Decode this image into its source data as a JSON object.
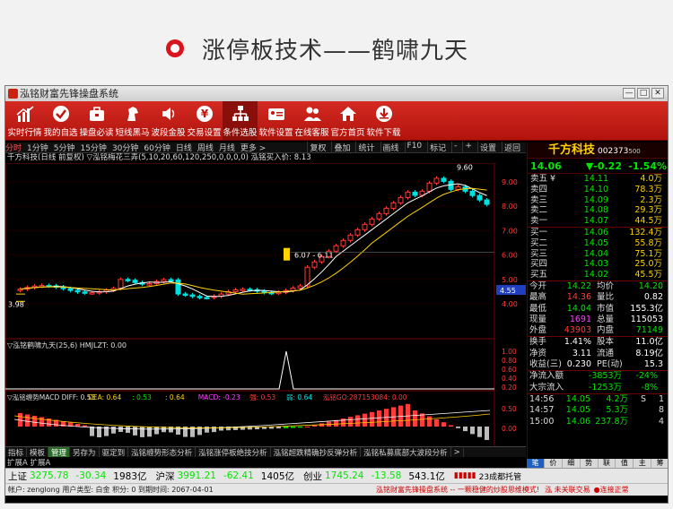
{
  "banner": {
    "title": "涨停板技术——鹤啸九天"
  },
  "window": {
    "title": "泓铭财富先锋操盘系统",
    "controls": [
      "—",
      "□",
      "✕"
    ]
  },
  "toolbar": [
    {
      "label": "实时行情",
      "icon": "bar-chart-icon"
    },
    {
      "label": "我的自选",
      "icon": "checkmark-circle-icon"
    },
    {
      "label": "操盘必读",
      "icon": "briefcase-icon"
    },
    {
      "label": "短线黑马",
      "icon": "horse-icon"
    },
    {
      "label": "波段金股",
      "icon": "speaker-icon"
    },
    {
      "label": "交易设置",
      "icon": "yen-coin-icon"
    },
    {
      "label": "条件选股",
      "icon": "hierarchy-icon"
    },
    {
      "label": "软件设置",
      "icon": "id-card-icon"
    },
    {
      "label": "在线客服",
      "icon": "users-icon"
    },
    {
      "label": "官方首页",
      "icon": "home-icon"
    },
    {
      "label": "软件下载",
      "icon": "download-icon"
    }
  ],
  "period_bar": {
    "items": [
      "分时",
      "1分钟",
      "5分钟",
      "15分钟",
      "30分钟",
      "60分钟",
      "日线",
      "周线",
      "月线",
      "更多 >"
    ],
    "selected": "日线",
    "right": [
      "复权",
      "叠加",
      "统计",
      "画线",
      "F10",
      "标记",
      "-",
      "+",
      "设置",
      "返回"
    ]
  },
  "main_chart": {
    "info_line": "千方科技(日线 前复权) ▽泓铭梅花三弄(5,10,20,60,120,250,0,0,0,0)  泓铭买入价: 8.13",
    "high_label": "9.60",
    "low_label": "3.98",
    "mid_label": "6.07 - 6.11",
    "y_ticks": [
      "9.00",
      "8.00",
      "7.00",
      "6.00",
      "5.00",
      "4.00"
    ],
    "current_price_tag": "4.55"
  },
  "sub_chart_1": {
    "info_line": "▽泓铭鹤啸九天(25,6)  HMJLZT: 0.00",
    "y_ticks": [
      "1.00",
      "0.80",
      "0.60",
      "0.40",
      "0.20"
    ]
  },
  "sub_chart_2": {
    "info_line_parts": [
      {
        "text": "▽泓铭缠势MACD  DIFF: 0.53",
        "color": "white"
      },
      {
        "text": "  DEA: 0.64",
        "color": "yellow"
      },
      {
        "text": "  : 0.53",
        "color": "green"
      },
      {
        "text": "  : 0.64",
        "color": "yellow"
      },
      {
        "text": "  MACD: -0.23",
        "color": "magenta"
      },
      {
        "text": "  强: 0.53",
        "color": "red"
      },
      {
        "text": "  弱: 0.64",
        "color": "cyan"
      },
      {
        "text": "  泓铭GO:287153084: 0.00",
        "color": "red"
      }
    ],
    "y_ticks": [
      "0.50",
      "0.00"
    ]
  },
  "x_axis": {
    "labels": [
      "2013年",
      "12",
      "2",
      "3"
    ],
    "right_label": "日线"
  },
  "bottom_tabs": {
    "items": [
      "指标",
      "模板",
      "管理",
      "另存为",
      "驱定到",
      "泓铭缠势形态分析",
      "泓铭涨停板绝技分析",
      "泓铭超跌精确抄反弹分析",
      "泓铭私募底部大波段分析",
      ">"
    ],
    "selected": "管理",
    "row2": "扩展A  扩展A"
  },
  "quote_panel": {
    "name": "千方科技",
    "code": "002373",
    "code_suffix": "500",
    "price": "14.06",
    "change": "▼-0.22",
    "change_pct": "-1.54%",
    "asks": [
      {
        "label": "卖五",
        "mark": "¥",
        "price": "14.11",
        "vol": "4.0万"
      },
      {
        "label": "卖四",
        "price": "14.10",
        "vol": "78.3万"
      },
      {
        "label": "卖三",
        "price": "14.09",
        "vol": "2.3万"
      },
      {
        "label": "卖二",
        "price": "14.08",
        "vol": "29.3万"
      },
      {
        "label": "卖一",
        "price": "14.07",
        "vol": "44.5万"
      }
    ],
    "bids": [
      {
        "label": "买一",
        "price": "14.06",
        "vol": "132.4万"
      },
      {
        "label": "买二",
        "price": "14.05",
        "vol": "55.8万"
      },
      {
        "label": "买三",
        "price": "14.04",
        "vol": "75.1万"
      },
      {
        "label": "买四",
        "price": "14.03",
        "vol": "25.0万"
      },
      {
        "label": "买五",
        "price": "14.02",
        "vol": "45.5万"
      }
    ],
    "stats": [
      {
        "a": "今开",
        "b": "14.22",
        "bc": "green",
        "c": "均价",
        "d": "14.20",
        "dc": "green"
      },
      {
        "a": "最高",
        "b": "14.36",
        "bc": "red",
        "c": "量比",
        "d": "0.82",
        "dc": "white"
      },
      {
        "a": "最低",
        "b": "14.04",
        "bc": "green",
        "c": "市值",
        "d": "155.3亿",
        "dc": "white"
      },
      {
        "a": "现量",
        "b": "1691",
        "bc": "magenta",
        "c": "总量",
        "d": "115053",
        "dc": "white"
      },
      {
        "a": "外盘",
        "b": "43903",
        "bc": "red",
        "c": "内盘",
        "d": "71149",
        "dc": "green"
      }
    ],
    "stats2": [
      {
        "a": "换手",
        "b": "1.41%",
        "bc": "white",
        "c": "股本",
        "d": "11.0亿",
        "dc": "white"
      },
      {
        "a": "净资",
        "b": "3.11",
        "bc": "white",
        "c": "流通",
        "d": "8.19亿",
        "dc": "white"
      },
      {
        "a": "收益(三)",
        "b": "0.230",
        "bc": "white",
        "c": "PE(动)",
        "d": "15.3",
        "dc": "white"
      }
    ],
    "flows": [
      {
        "label": "净流入额",
        "val": "-3853万",
        "pct": "-24%"
      },
      {
        "label": "大宗流入",
        "val": "-1253万",
        "pct": "-8%"
      }
    ],
    "ticks": [
      {
        "t": "14:56",
        "p": "14.05",
        "v": "4.2万",
        "f": "S",
        "n": "1"
      },
      {
        "t": "14:57",
        "p": "14.05",
        "v": "5.3万",
        "f": "",
        "n": "8"
      },
      {
        "t": "15:00",
        "p": "14.06",
        "v": "237.8万",
        "f": "",
        "n": "4"
      }
    ],
    "foot_tabs": [
      "笔",
      "价",
      "细",
      "势",
      "联",
      "值",
      "主",
      "筹"
    ]
  },
  "index_bar": {
    "sh_label": "上证",
    "sh_val": "3275.78",
    "sh_chg": "-30.34",
    "sh_amt": "1983亿",
    "sz_label": "沪深",
    "sz_val": "3991.21",
    "sz_chg": "-62.41",
    "sz_amt": "1405亿",
    "cy_label": "创业",
    "cy_val": "1745.24",
    "cy_chg": "-13.58",
    "cy_amt": "543.1亿",
    "extra": "23成都托管"
  },
  "status_bar": {
    "account": "帐户: zenglong  用户类型: 白金  积分: 0  到期时间: 2067-04-01",
    "slogan": "泓铭财富先锋操盘系统 -- 一颗稳健的炒股思维模式!",
    "conn": "泓  未关联交易",
    "conn2": "●连接正常"
  }
}
